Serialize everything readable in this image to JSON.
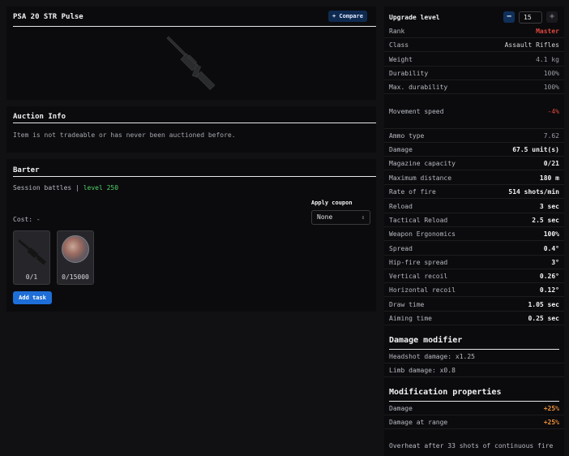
{
  "item": {
    "title": "PSA 20 STR Pulse",
    "compare_label": "+ Compare"
  },
  "auction": {
    "title": "Auction Info",
    "message": "Item is not tradeable or has never been auctioned before."
  },
  "barter": {
    "title": "Barter",
    "source_text": "Session battles |",
    "level_text": "level 250",
    "coupon_label": "Apply coupon",
    "coupon_value": "None",
    "cost_label": "Cost: -",
    "slots": [
      {
        "count": "0/1"
      },
      {
        "count": "0/15000"
      }
    ],
    "add_task_label": "Add task"
  },
  "stats": {
    "upgrade_label": "Upgrade level",
    "upgrade_value": "15",
    "minus": "−",
    "plus": "+",
    "rows": [
      {
        "label": "Rank",
        "value": "Master"
      },
      {
        "label": "Class",
        "value": "Assault Rifles"
      },
      {
        "label": "Weight",
        "value": "4.1 kg"
      },
      {
        "label": "Durability",
        "value": "100%"
      },
      {
        "label": "Max. durability",
        "value": "100%"
      },
      {
        "label": "Movement speed",
        "value": "-4%"
      },
      {
        "label": "Ammo type",
        "value": "7.62"
      },
      {
        "label": "Damage",
        "value": "67.5 unit(s)"
      },
      {
        "label": "Magazine capacity",
        "value": "0/21"
      },
      {
        "label": "Maximum distance",
        "value": "180 m"
      },
      {
        "label": "Rate of fire",
        "value": "514 shots/min"
      },
      {
        "label": "Reload",
        "value": "3 sec"
      },
      {
        "label": "Tactical Reload",
        "value": "2.5 sec"
      },
      {
        "label": "Weapon Ergonomics",
        "value": "100%"
      },
      {
        "label": "Spread",
        "value": "0.4°"
      },
      {
        "label": "Hip-fire spread",
        "value": "3°"
      },
      {
        "label": "Vertical recoil",
        "value": "0.26°"
      },
      {
        "label": "Horizontal recoil",
        "value": "0.12°"
      },
      {
        "label": "Draw time",
        "value": "1.05 sec"
      },
      {
        "label": "Aiming time",
        "value": "0.25 sec"
      }
    ]
  },
  "damage_modifier": {
    "title": "Damage modifier",
    "rows": [
      {
        "label": "Headshot damage: x1.25"
      },
      {
        "label": "Limb damage: x0.8"
      }
    ]
  },
  "modification": {
    "title": "Modification properties",
    "rows": [
      {
        "label": "Damage",
        "value": "+25%"
      },
      {
        "label": "Damage at range",
        "value": "+25%"
      }
    ],
    "note": "Overheat after 33 shots of continuous fire"
  },
  "colors": {
    "accent_blue": "#1e6ed8",
    "rank_red": "#e0483f",
    "level_green": "#4fd16b",
    "bonus_orange": "#f2923a"
  }
}
